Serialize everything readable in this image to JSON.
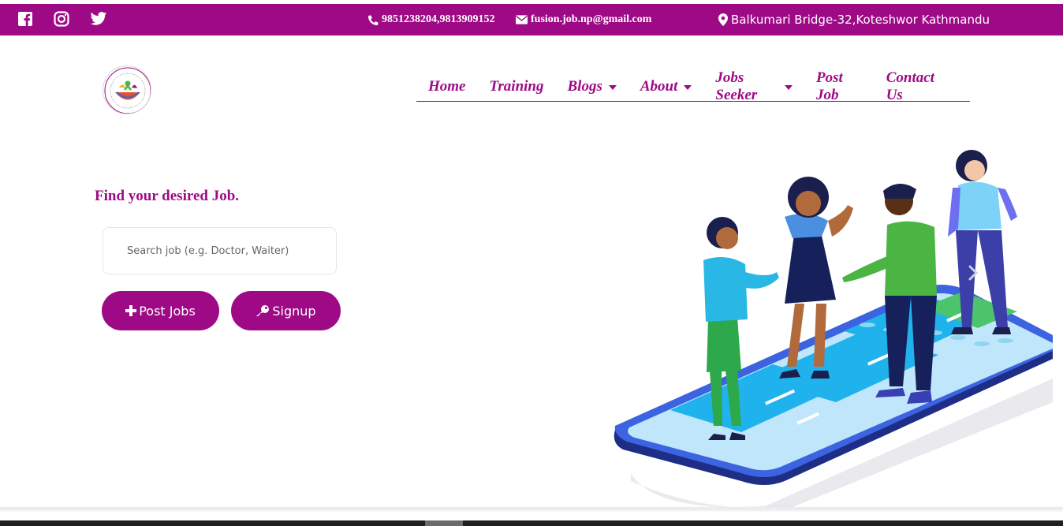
{
  "topbar": {
    "social": [
      {
        "name": "facebook-icon"
      },
      {
        "name": "instagram-icon"
      },
      {
        "name": "twitter-icon"
      }
    ],
    "phone": "9851238204,9813909152",
    "email": "fusion.job.np@gmail.com",
    "address": "Balkumari Bridge-32,Koteshwor Kathmandu",
    "bg_color": "#9e0a86"
  },
  "nav": {
    "items": [
      {
        "label": "Home",
        "dropdown": false
      },
      {
        "label": "Training",
        "dropdown": false
      },
      {
        "label": "Blogs",
        "dropdown": true
      },
      {
        "label": "About",
        "dropdown": true
      },
      {
        "label": "Jobs Seeker",
        "dropdown": true
      },
      {
        "label": "Post Job",
        "dropdown": false
      },
      {
        "label": "Contact Us",
        "dropdown": false
      }
    ]
  },
  "hero": {
    "title": "Find your desired Job.",
    "search_placeholder": "Search job (e.g. Doctor, Waiter)",
    "post_jobs_label": "Post Jobs",
    "signup_label": "Signup"
  },
  "colors": {
    "accent": "#9e0a86"
  }
}
